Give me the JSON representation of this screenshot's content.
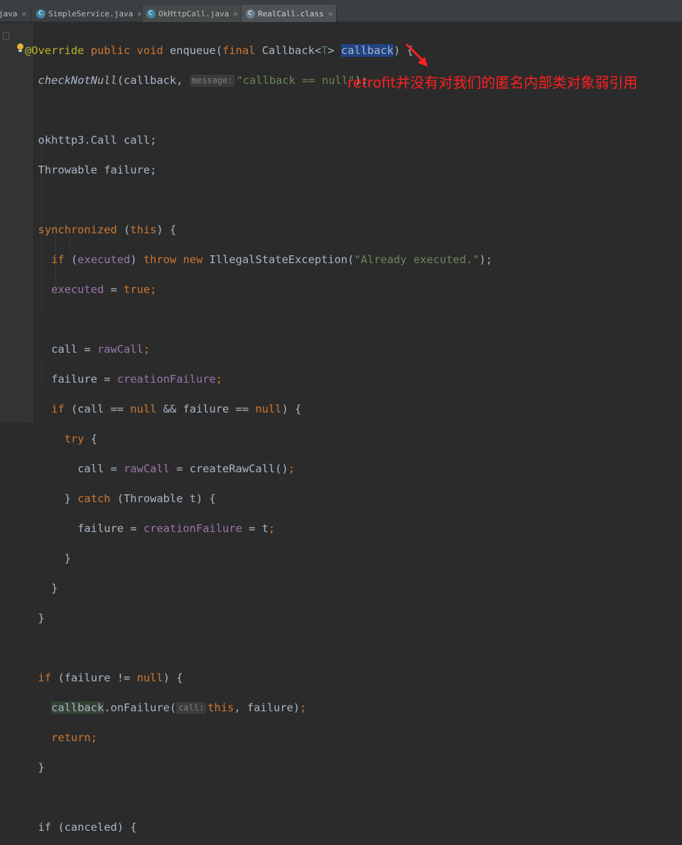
{
  "tabs": [
    {
      "label": "java",
      "close": "×"
    },
    {
      "label": "SimpleService.java",
      "close": "×"
    },
    {
      "label": "OkHttpCall.java",
      "close": "×"
    },
    {
      "label": "RealCall.class",
      "close": "×"
    }
  ],
  "annotation": {
    "text": "retrofit并没有对我们的匿名内部类对象弱引用",
    "color": "#ff2020"
  },
  "code": {
    "l1_ann": "@Override",
    "l1_pub": "public",
    "l1_void": "void",
    "l1_name": "enqueue(",
    "l1_final": "final",
    "l1_type": "Callback<",
    "l1_t": "T",
    "l1_gt": "> ",
    "l1_param": "callback",
    "l1_end": ") {",
    "l2_call": "checkNotNull",
    "l2_open": "(callback, ",
    "l2_hint": "message:",
    "l2_str": "\"callback == null\"",
    "l2_end": ");",
    "l4": "okhttp3.Call call;",
    "l5": "Throwable failure;",
    "l7_kw": "synchronized",
    "l7_open": " (",
    "l7_this": "this",
    "l7_end": ") {",
    "l8_if": "if",
    "l8_open": " (",
    "l8_fld": "executed",
    "l8_close": ") ",
    "l8_throw": "throw",
    "l8_new": "new",
    "l8_cls": "IllegalStateException(",
    "l8_str": "\"Already executed.\"",
    "l8_end": ");",
    "l9_fld": "executed",
    "l9_eq": " = ",
    "l9_true": "true",
    "l9_end": ";",
    "l11_a": "call = ",
    "l11_fld": "rawCall",
    "l11_end": ";",
    "l12_a": "failure = ",
    "l12_fld": "creationFailure",
    "l12_end": ";",
    "l13_if": "if",
    "l13_a": " (call == ",
    "l13_null1": "null",
    "l13_b": " && failure == ",
    "l13_null2": "null",
    "l13_end": ") {",
    "l14_try": "try",
    "l14_end": " {",
    "l15_a": "call = ",
    "l15_fld": "rawCall",
    "l15_b": " = createRawCall()",
    "l15_end": ";",
    "l16_a": "} ",
    "l16_catch": "catch",
    "l16_b": " (Throwable t) {",
    "l17_a": "failure = ",
    "l17_fld": "creationFailure",
    "l17_b": " = t",
    "l17_end": ";",
    "brace": "}",
    "l22_if": "if",
    "l22_a": " (failure != ",
    "l22_null": "null",
    "l22_end": ") {",
    "l23_param": "callback",
    "l23_a": ".onFailure(",
    "l23_hint": "call:",
    "l23_this": "this",
    "l23_b": ", failure)",
    "l23_end": ";",
    "l24_ret": "return",
    "l24_end": ";",
    "l27": "if (canceled) {"
  }
}
